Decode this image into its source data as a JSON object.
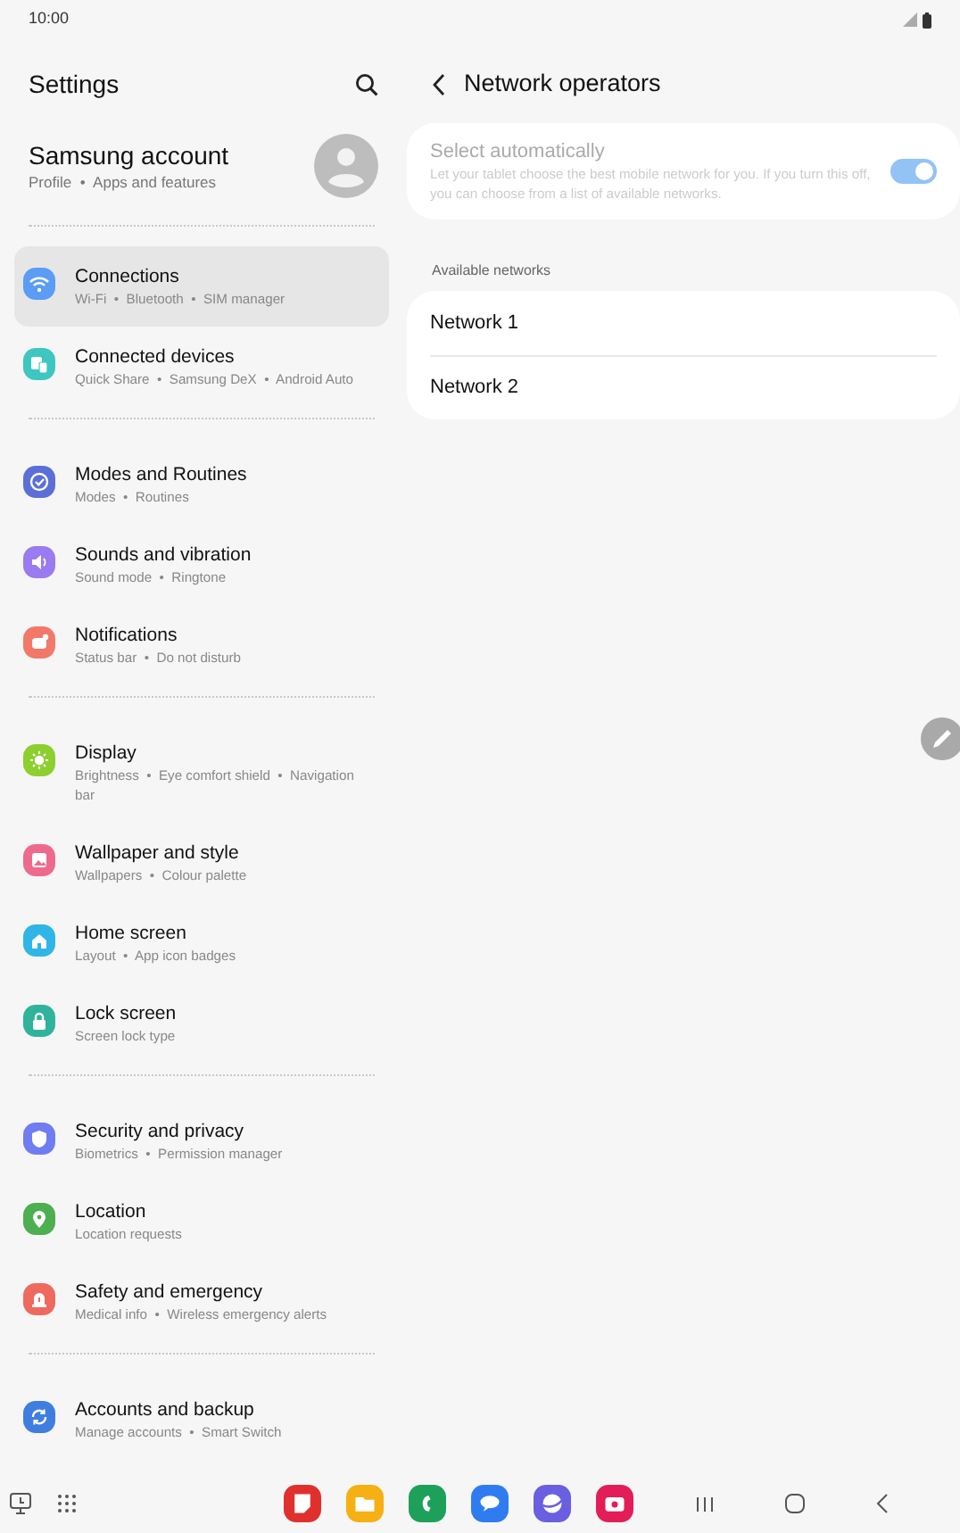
{
  "status_bar": {
    "time": "10:00"
  },
  "settings": {
    "title": "Settings",
    "account": {
      "name": "Samsung account",
      "subtitle": "Profile  •  Apps and features"
    },
    "groups": [
      [
        {
          "color": "#5b9cf5",
          "title": "Connections",
          "subtitle": "Wi-Fi  •  Bluetooth  •  SIM manager",
          "selected": true
        },
        {
          "color": "#3ec6c0",
          "title": "Connected devices",
          "subtitle": "Quick Share  •  Samsung DeX  •  Android Auto",
          "selected": false
        }
      ],
      [
        {
          "color": "#5b6fd8",
          "title": "Modes and Routines",
          "subtitle": "Modes  •  Routines",
          "selected": false
        },
        {
          "color": "#9a7bf0",
          "title": "Sounds and vibration",
          "subtitle": "Sound mode  •  Ringtone",
          "selected": false
        },
        {
          "color": "#f2786a",
          "title": "Notifications",
          "subtitle": "Status bar  •  Do not disturb",
          "selected": false
        }
      ],
      [
        {
          "color": "#8dcf2e",
          "title": "Display",
          "subtitle": "Brightness  •  Eye comfort shield  •  Navigation bar",
          "selected": false
        },
        {
          "color": "#ee6a8c",
          "title": "Wallpaper and style",
          "subtitle": "Wallpapers  •  Colour palette",
          "selected": false
        },
        {
          "color": "#2fb6e6",
          "title": "Home screen",
          "subtitle": "Layout  •  App icon badges",
          "selected": false
        },
        {
          "color": "#2fb39a",
          "title": "Lock screen",
          "subtitle": "Screen lock type",
          "selected": false
        }
      ],
      [
        {
          "color": "#6f7cf2",
          "title": "Security and privacy",
          "subtitle": "Biometrics  •  Permission manager",
          "selected": false
        },
        {
          "color": "#4caf50",
          "title": "Location",
          "subtitle": "Location requests",
          "selected": false
        },
        {
          "color": "#ee6a5e",
          "title": "Safety and emergency",
          "subtitle": "Medical info  •  Wireless emergency alerts",
          "selected": false
        }
      ],
      [
        {
          "color": "#3f7ee0",
          "title": "Accounts and backup",
          "subtitle": "Manage accounts  •  Smart Switch",
          "selected": false
        }
      ]
    ]
  },
  "network_operators": {
    "title": "Network operators",
    "select_automatically": {
      "title": "Select automatically",
      "description": "Let your tablet choose the best mobile network for you. If you turn this off, you can choose from a list of available networks.",
      "on": true,
      "disabled": true
    },
    "section_label": "Available networks",
    "networks": [
      {
        "name": "Network 1"
      },
      {
        "name": "Network 2"
      }
    ]
  },
  "taskbar": {
    "apps": [
      {
        "color": "#e0302e"
      },
      {
        "color": "#f5b014"
      },
      {
        "color": "#1da15a"
      },
      {
        "color": "#2f7cf0"
      },
      {
        "color": "#6a5fe0"
      },
      {
        "color": "#e31d57"
      }
    ]
  }
}
